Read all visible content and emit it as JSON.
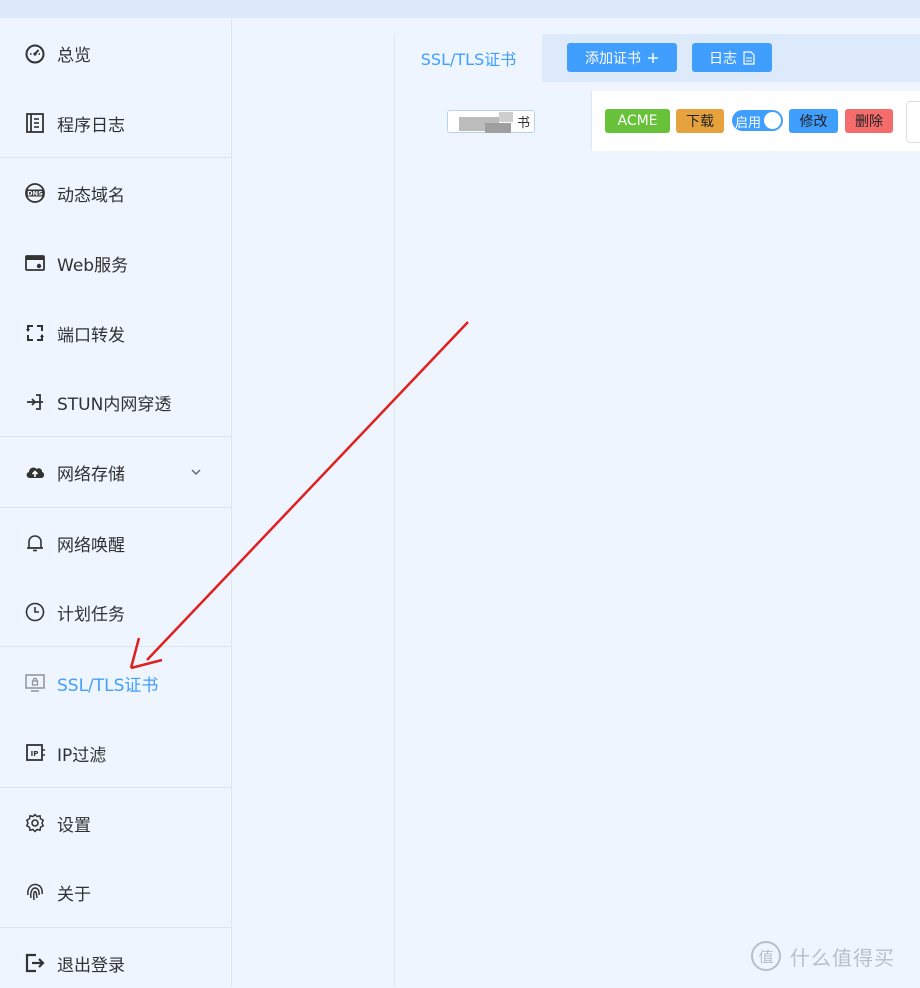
{
  "sidebar": {
    "items": [
      {
        "label": "总览",
        "icon": "dashboard-icon",
        "active": false
      },
      {
        "label": "程序日志",
        "icon": "log-document-icon",
        "active": false
      },
      {
        "label": "动态域名",
        "icon": "dns-icon",
        "active": false
      },
      {
        "label": "Web服务",
        "icon": "web-window-icon",
        "active": false
      },
      {
        "label": "端口转发",
        "icon": "port-forward-icon",
        "active": false
      },
      {
        "label": "STUN内网穿透",
        "icon": "stun-icon",
        "active": false
      },
      {
        "label": "网络存储",
        "icon": "cloud-upload-icon",
        "active": false,
        "has_submenu": true
      },
      {
        "label": "网络唤醒",
        "icon": "bell-icon",
        "active": false
      },
      {
        "label": "计划任务",
        "icon": "clock-icon",
        "active": false
      },
      {
        "label": "SSL/TLS证书",
        "icon": "certificate-monitor-icon",
        "active": true
      },
      {
        "label": "IP过滤",
        "icon": "ip-filter-icon",
        "active": false
      },
      {
        "label": "设置",
        "icon": "gear-icon",
        "active": false
      },
      {
        "label": "关于",
        "icon": "fingerprint-icon",
        "active": false
      },
      {
        "label": "退出登录",
        "icon": "logout-icon",
        "active": false
      }
    ]
  },
  "tabs": {
    "active_label": "SSL/TLS证书"
  },
  "toolbar": {
    "add_cert_label": "添加证书",
    "log_label": "日志"
  },
  "cert_row": {
    "name_suffix": "书",
    "acme_label": "ACME",
    "download_label": "下载",
    "enable_label": "启用",
    "enabled": true,
    "edit_label": "修改",
    "delete_label": "删除"
  },
  "watermark": {
    "text": "什么值得买",
    "logo_char": "值"
  },
  "colors": {
    "accent": "#409eff",
    "acme_green": "#67c23a",
    "download_orange": "#e6a23c",
    "delete_red": "#f56c6c",
    "annotation_arrow": "#e02020"
  }
}
